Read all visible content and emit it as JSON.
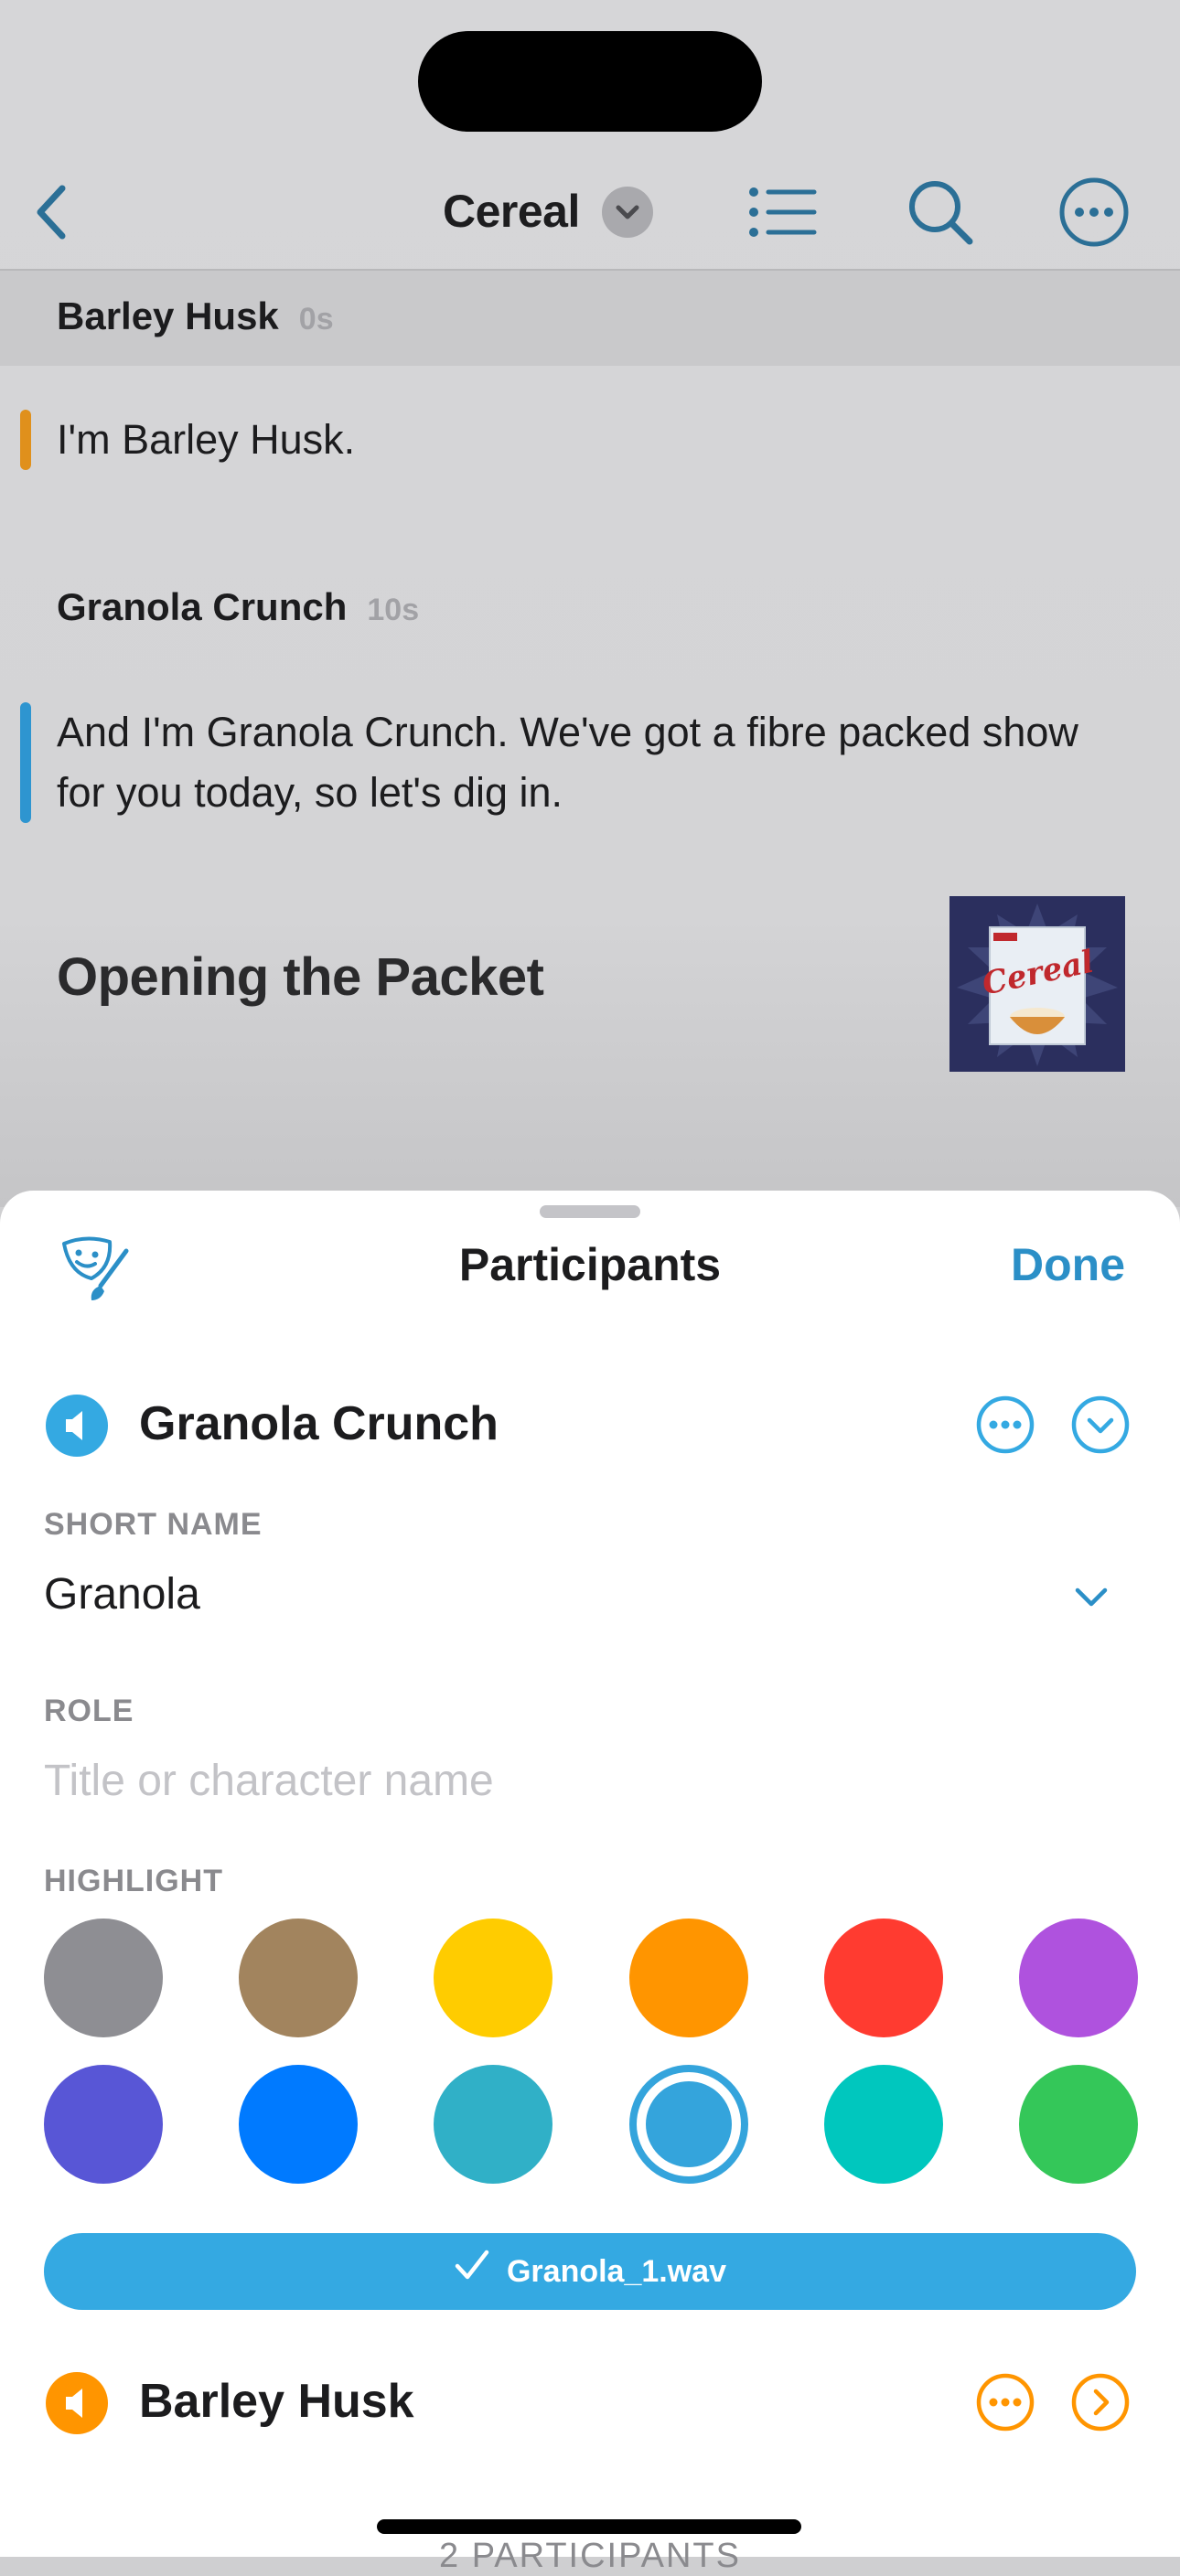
{
  "navbar": {
    "title": "Cereal"
  },
  "transcript": {
    "segments": [
      {
        "speaker": "Barley Husk",
        "time": "0s",
        "text": "I'm Barley Husk.",
        "bar_color": "#e0901c"
      },
      {
        "speaker": "Granola Crunch",
        "time": "10s",
        "text": "And I'm Granola Crunch. We've got a fibre packed show for you today, so let's dig in.",
        "bar_color": "#2e95d0"
      }
    ],
    "chapter": {
      "title": "Opening the Packet",
      "artwork_label": "Cereal"
    }
  },
  "sheet": {
    "title": "Participants",
    "done_label": "Done",
    "participants": [
      {
        "name": "Granola Crunch",
        "color": "#34a9e2",
        "expanded": true,
        "short_name_label": "SHORT NAME",
        "short_name": "Granola",
        "role_label": "ROLE",
        "role_placeholder": "Title or character name",
        "highlight_label": "HIGHLIGHT",
        "highlight_colors": [
          "#8e8e93",
          "#a2845e",
          "#ffcc00",
          "#ff9500",
          "#ff3b30",
          "#af52de",
          "#5856d6",
          "#007aff",
          "#30b0c7",
          "#34a9e2",
          "#00c7be",
          "#34c759"
        ],
        "selected_color": "#34a9e2",
        "audio_file": "Granola_1.wav"
      },
      {
        "name": "Barley Husk",
        "color": "#ff9500",
        "expanded": false
      }
    ],
    "count_label": "2 PARTICIPANTS"
  }
}
